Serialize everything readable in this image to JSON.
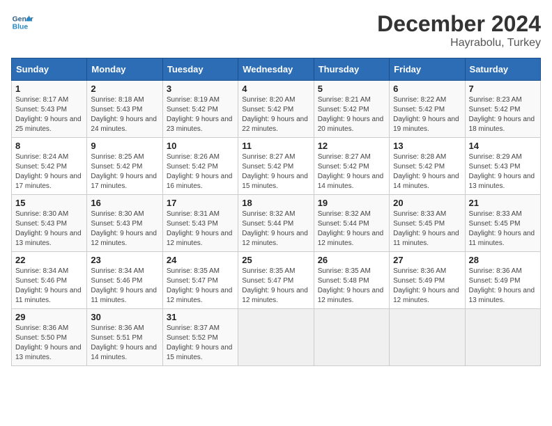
{
  "header": {
    "logo_line1": "General",
    "logo_line2": "Blue",
    "month": "December 2024",
    "location": "Hayrabolu, Turkey"
  },
  "days_of_week": [
    "Sunday",
    "Monday",
    "Tuesday",
    "Wednesday",
    "Thursday",
    "Friday",
    "Saturday"
  ],
  "weeks": [
    [
      {
        "day": "1",
        "sunrise": "8:17 AM",
        "sunset": "5:43 PM",
        "daylight": "9 hours and 25 minutes."
      },
      {
        "day": "2",
        "sunrise": "8:18 AM",
        "sunset": "5:43 PM",
        "daylight": "9 hours and 24 minutes."
      },
      {
        "day": "3",
        "sunrise": "8:19 AM",
        "sunset": "5:42 PM",
        "daylight": "9 hours and 23 minutes."
      },
      {
        "day": "4",
        "sunrise": "8:20 AM",
        "sunset": "5:42 PM",
        "daylight": "9 hours and 22 minutes."
      },
      {
        "day": "5",
        "sunrise": "8:21 AM",
        "sunset": "5:42 PM",
        "daylight": "9 hours and 20 minutes."
      },
      {
        "day": "6",
        "sunrise": "8:22 AM",
        "sunset": "5:42 PM",
        "daylight": "9 hours and 19 minutes."
      },
      {
        "day": "7",
        "sunrise": "8:23 AM",
        "sunset": "5:42 PM",
        "daylight": "9 hours and 18 minutes."
      }
    ],
    [
      {
        "day": "8",
        "sunrise": "8:24 AM",
        "sunset": "5:42 PM",
        "daylight": "9 hours and 17 minutes."
      },
      {
        "day": "9",
        "sunrise": "8:25 AM",
        "sunset": "5:42 PM",
        "daylight": "9 hours and 17 minutes."
      },
      {
        "day": "10",
        "sunrise": "8:26 AM",
        "sunset": "5:42 PM",
        "daylight": "9 hours and 16 minutes."
      },
      {
        "day": "11",
        "sunrise": "8:27 AM",
        "sunset": "5:42 PM",
        "daylight": "9 hours and 15 minutes."
      },
      {
        "day": "12",
        "sunrise": "8:27 AM",
        "sunset": "5:42 PM",
        "daylight": "9 hours and 14 minutes."
      },
      {
        "day": "13",
        "sunrise": "8:28 AM",
        "sunset": "5:42 PM",
        "daylight": "9 hours and 14 minutes."
      },
      {
        "day": "14",
        "sunrise": "8:29 AM",
        "sunset": "5:43 PM",
        "daylight": "9 hours and 13 minutes."
      }
    ],
    [
      {
        "day": "15",
        "sunrise": "8:30 AM",
        "sunset": "5:43 PM",
        "daylight": "9 hours and 13 minutes."
      },
      {
        "day": "16",
        "sunrise": "8:30 AM",
        "sunset": "5:43 PM",
        "daylight": "9 hours and 12 minutes."
      },
      {
        "day": "17",
        "sunrise": "8:31 AM",
        "sunset": "5:43 PM",
        "daylight": "9 hours and 12 minutes."
      },
      {
        "day": "18",
        "sunrise": "8:32 AM",
        "sunset": "5:44 PM",
        "daylight": "9 hours and 12 minutes."
      },
      {
        "day": "19",
        "sunrise": "8:32 AM",
        "sunset": "5:44 PM",
        "daylight": "9 hours and 12 minutes."
      },
      {
        "day": "20",
        "sunrise": "8:33 AM",
        "sunset": "5:45 PM",
        "daylight": "9 hours and 11 minutes."
      },
      {
        "day": "21",
        "sunrise": "8:33 AM",
        "sunset": "5:45 PM",
        "daylight": "9 hours and 11 minutes."
      }
    ],
    [
      {
        "day": "22",
        "sunrise": "8:34 AM",
        "sunset": "5:46 PM",
        "daylight": "9 hours and 11 minutes."
      },
      {
        "day": "23",
        "sunrise": "8:34 AM",
        "sunset": "5:46 PM",
        "daylight": "9 hours and 11 minutes."
      },
      {
        "day": "24",
        "sunrise": "8:35 AM",
        "sunset": "5:47 PM",
        "daylight": "9 hours and 12 minutes."
      },
      {
        "day": "25",
        "sunrise": "8:35 AM",
        "sunset": "5:47 PM",
        "daylight": "9 hours and 12 minutes."
      },
      {
        "day": "26",
        "sunrise": "8:35 AM",
        "sunset": "5:48 PM",
        "daylight": "9 hours and 12 minutes."
      },
      {
        "day": "27",
        "sunrise": "8:36 AM",
        "sunset": "5:49 PM",
        "daylight": "9 hours and 12 minutes."
      },
      {
        "day": "28",
        "sunrise": "8:36 AM",
        "sunset": "5:49 PM",
        "daylight": "9 hours and 13 minutes."
      }
    ],
    [
      {
        "day": "29",
        "sunrise": "8:36 AM",
        "sunset": "5:50 PM",
        "daylight": "9 hours and 13 minutes."
      },
      {
        "day": "30",
        "sunrise": "8:36 AM",
        "sunset": "5:51 PM",
        "daylight": "9 hours and 14 minutes."
      },
      {
        "day": "31",
        "sunrise": "8:37 AM",
        "sunset": "5:52 PM",
        "daylight": "9 hours and 15 minutes."
      },
      null,
      null,
      null,
      null
    ]
  ]
}
